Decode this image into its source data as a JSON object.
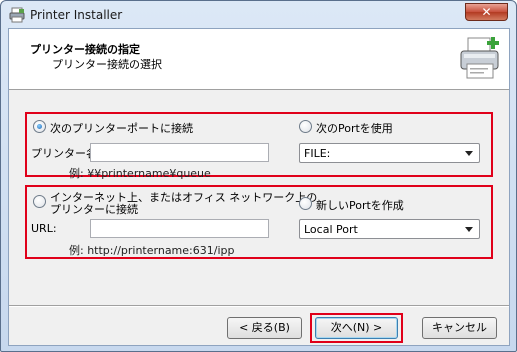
{
  "window": {
    "title": "Printer Installer",
    "close_label": "✕"
  },
  "header": {
    "title": "プリンター接続の指定",
    "subtitle": "プリンター接続の選択"
  },
  "group1": {
    "radio_port_label": "次のプリンターポートに接続",
    "printer_name_label": "プリンター名",
    "printer_name_value": "",
    "example": "例: ¥¥printername¥queue",
    "radio_use_port_label": "次のPortを使用",
    "port_select_value": "FILE:"
  },
  "group2": {
    "radio_internet_label_line1": "インターネット上、またはオフィス ネットワーク上の",
    "radio_internet_label_line2": "プリンターに接続",
    "url_label": "URL:",
    "url_value": "",
    "example": "例: http://printername:631/ipp",
    "radio_new_port_label": "新しいPortを作成",
    "new_port_select_value": "Local Port"
  },
  "buttons": {
    "back": "< 戻る(B)",
    "next": "次へ(N) >",
    "cancel": "キャンセル"
  },
  "colors": {
    "highlight": "#e0001a",
    "accent": "#3c7fb1"
  }
}
